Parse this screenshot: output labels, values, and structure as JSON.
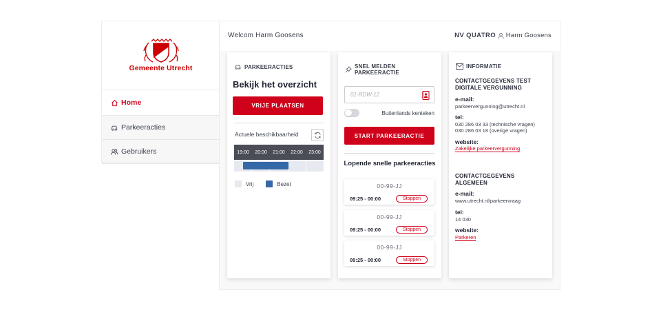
{
  "brand": {
    "logo_text": "Gemeente Utrecht",
    "accent": "#d0021b"
  },
  "sidebar": {
    "items": [
      {
        "label": "Home",
        "icon": "home-icon",
        "active": true
      },
      {
        "label": "Parkeeracties",
        "icon": "car-icon",
        "active": false
      },
      {
        "label": "Gebruikers",
        "icon": "users-icon",
        "active": false
      }
    ]
  },
  "header": {
    "welcome": "Welcom Harm Goosens",
    "company": "NV QUATRO",
    "user": "Harm Goosens"
  },
  "parkeeracties": {
    "heading": "PARKEERACTIES",
    "title": "Bekijk het overzicht",
    "button": "VRIJE PLAATSEN",
    "availability_label": "Actuele beschikbaarheid",
    "timeline_hours": [
      "19:00",
      "20:00",
      "21:00",
      "22:00",
      "23:00"
    ],
    "legend": {
      "free": "Vrij",
      "occupied": "Bezet"
    },
    "colors": {
      "occupied": "#3568a8",
      "free": "#e6e9ef"
    }
  },
  "snel": {
    "heading": "SNEL MELDEN PARKEERACTIE",
    "plate_placeholder": "01-RDW-12",
    "toggle_label": "Buitenlands kenteken",
    "button": "START PARKEERACTIE",
    "running_title": "Lopende snelle parkeeracties",
    "running": [
      {
        "plate": "00-99-JJ",
        "time": "09:25 - 00:00",
        "action": "Stoppen"
      },
      {
        "plate": "00-99-JJ",
        "time": "09:25 - 00:00",
        "action": "Stoppen"
      },
      {
        "plate": "00-99-JJ",
        "time": "09:25 - 00:00",
        "action": "Stoppen"
      }
    ]
  },
  "informatie": {
    "heading": "INFORMATIE",
    "section1": {
      "title": "CONTACTGEGEVENS TEST DIGITALE VERGUNNING",
      "email_label": "e-mail:",
      "email": "parkeervergunning@utrecht.nl",
      "tel_label": "tel:",
      "tel1": "030 286 03 33 (technische vragen)",
      "tel2": "030 286 03 18 (overige vragen)",
      "website_label": "website:",
      "website": "Zakelijke parkeervergunning"
    },
    "section2": {
      "title": "CONTACTGEGEVENS ALGEMEEN",
      "email_label": "e-mail:",
      "email": "www.utrecht.nl/parkeervraag",
      "tel_label": "tel:",
      "tel": "14 030",
      "website_label": "website:",
      "website": "Parkeren"
    }
  }
}
